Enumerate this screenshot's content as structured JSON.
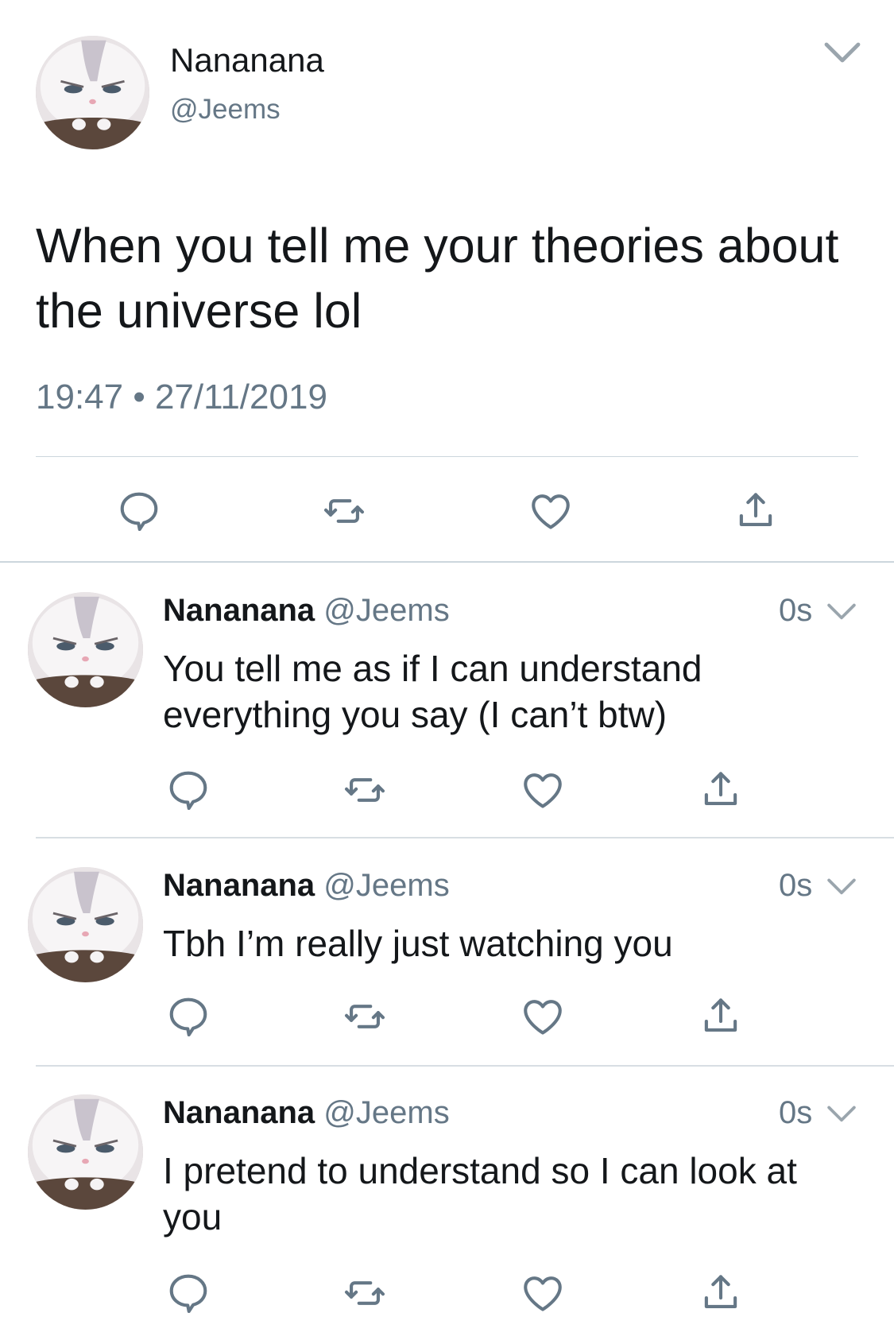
{
  "main": {
    "name": "Nananana",
    "handle": "@Jeems",
    "text": "When you tell me your theories about the universe lol",
    "timestamp": "19:47 • 27/11/2019"
  },
  "replies": [
    {
      "name": "Nananana",
      "handle": "@Jeems",
      "time": "0s",
      "text": "You tell me as if I can understand everything you say (I can’t btw)"
    },
    {
      "name": "Nananana",
      "handle": "@Jeems",
      "time": "0s",
      "text": "Tbh I’m really just watching you"
    },
    {
      "name": "Nananana",
      "handle": "@Jeems",
      "time": "0s",
      "text": "I pretend to understand so I can look at you"
    }
  ],
  "icons": [
    "avatar",
    "chevron-down-icon",
    "reply-icon",
    "retweet-icon",
    "like-icon",
    "share-icon"
  ],
  "colors": {
    "text": "#14171a",
    "secondary": "#657786",
    "icon": "#657786",
    "divider": "#ccd6dd"
  }
}
